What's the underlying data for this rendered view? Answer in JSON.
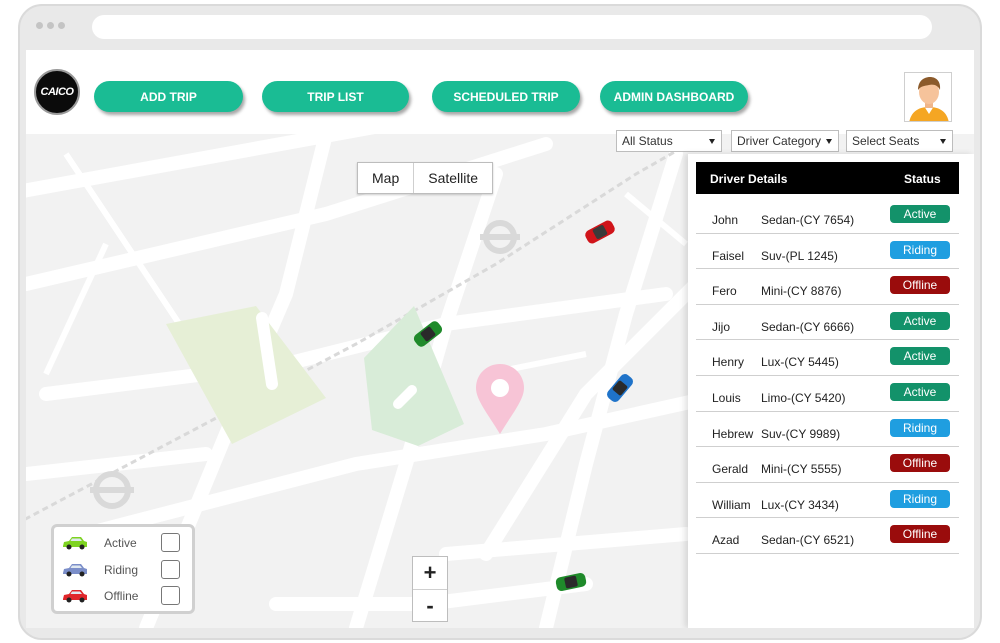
{
  "app": {
    "logo_text": "CAICO"
  },
  "nav": [
    {
      "label": "ADD TRIP"
    },
    {
      "label": "TRIP LIST"
    },
    {
      "label": "SCHEDULED TRIP"
    },
    {
      "label": "ADMIN DASHBOARD"
    }
  ],
  "filters": {
    "status": "All Status",
    "category": "Driver Category",
    "seats": "Select Seats"
  },
  "map_toggle": {
    "map": "Map",
    "satellite": "Satellite"
  },
  "panel": {
    "header_driver": "Driver Details",
    "header_status": "Status",
    "drivers": [
      {
        "name": "John",
        "car": "Sedan-(CY 7654)",
        "status": "Active"
      },
      {
        "name": "Faisel",
        "car": "Suv-(PL 1245)",
        "status": "Riding"
      },
      {
        "name": "Fero",
        "car": "Mini-(CY 8876)",
        "status": "Offline"
      },
      {
        "name": "Jijo",
        "car": "Sedan-(CY 6666)",
        "status": "Active"
      },
      {
        "name": "Henry",
        "car": "Lux-(CY 5445)",
        "status": "Active"
      },
      {
        "name": "Louis",
        "car": "Limo-(CY 5420)",
        "status": "Active"
      },
      {
        "name": "Hebrew",
        "car": "Suv-(CY 9989)",
        "status": "Riding"
      },
      {
        "name": "Gerald",
        "car": "Mini-(CY 5555)",
        "status": "Offline"
      },
      {
        "name": "William",
        "car": "Lux-(CY 3434)",
        "status": "Riding"
      },
      {
        "name": "Azad",
        "car": "Sedan-(CY 6521)",
        "status": "Offline"
      }
    ]
  },
  "status_colors": {
    "Active": "#13926a",
    "Riding": "#1f9ee0",
    "Offline": "#9a0c0c"
  },
  "legend": [
    {
      "label": "Active",
      "color": "#7ed321"
    },
    {
      "label": "Riding",
      "color": "#7b8ec9"
    },
    {
      "label": "Offline",
      "color": "#e0262b"
    }
  ],
  "zoom": {
    "in": "+",
    "out": "-"
  },
  "accent_color": "#1abc94"
}
